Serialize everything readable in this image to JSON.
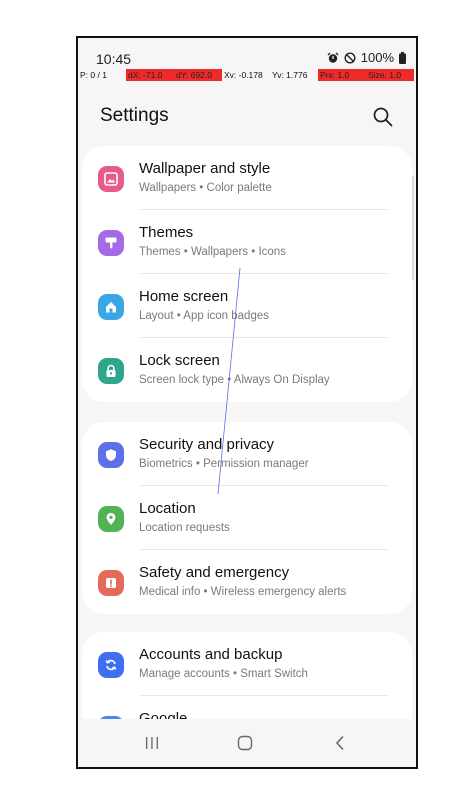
{
  "status_bar": {
    "time": "10:45",
    "battery": "100%"
  },
  "debug_overlay": {
    "pointer": "P: 0 / 1",
    "dx": "dX: -71.0",
    "dy": "dY: 692.0",
    "xv": "Xv: -0.178",
    "yv": "Yv: 1.776",
    "prs": "Prs: 1.0",
    "size": "Size: 1.0"
  },
  "header": {
    "title": "Settings",
    "search_icon": "search-icon"
  },
  "groups": [
    {
      "items": [
        {
          "title": "Wallpaper and style",
          "subtitle": "Wallpapers  •  Color palette",
          "icon": "wallpaper-icon",
          "color": "#e75a8a"
        },
        {
          "title": "Themes",
          "subtitle": "Themes  •  Wallpapers  •  Icons",
          "icon": "themes-brush-icon",
          "color": "#a56be6"
        },
        {
          "title": "Home screen",
          "subtitle": "Layout  •  App icon badges",
          "icon": "home-icon",
          "color": "#3aa6e6"
        },
        {
          "title": "Lock screen",
          "subtitle": "Screen lock type  •  Always On Display",
          "icon": "lock-icon",
          "color": "#2fa58c"
        }
      ]
    },
    {
      "items": [
        {
          "title": "Security and privacy",
          "subtitle": "Biometrics  •  Permission manager",
          "icon": "shield-icon",
          "color": "#5f6fe8"
        },
        {
          "title": "Location",
          "subtitle": "Location requests",
          "icon": "location-pin-icon",
          "color": "#52b354"
        },
        {
          "title": "Safety and emergency",
          "subtitle": "Medical info  •  Wireless emergency alerts",
          "icon": "alert-icon",
          "color": "#e46a5a"
        }
      ]
    },
    {
      "items": [
        {
          "title": "Accounts and backup",
          "subtitle": "Manage accounts  •  Smart Switch",
          "icon": "sync-icon",
          "color": "#3e6ff0"
        },
        {
          "title": "Google",
          "subtitle": "",
          "icon": "google-icon",
          "color": "#4f86ee"
        }
      ]
    }
  ],
  "nav_bar": {
    "recents": "recents-icon",
    "home": "home-button-icon",
    "back": "back-icon"
  }
}
